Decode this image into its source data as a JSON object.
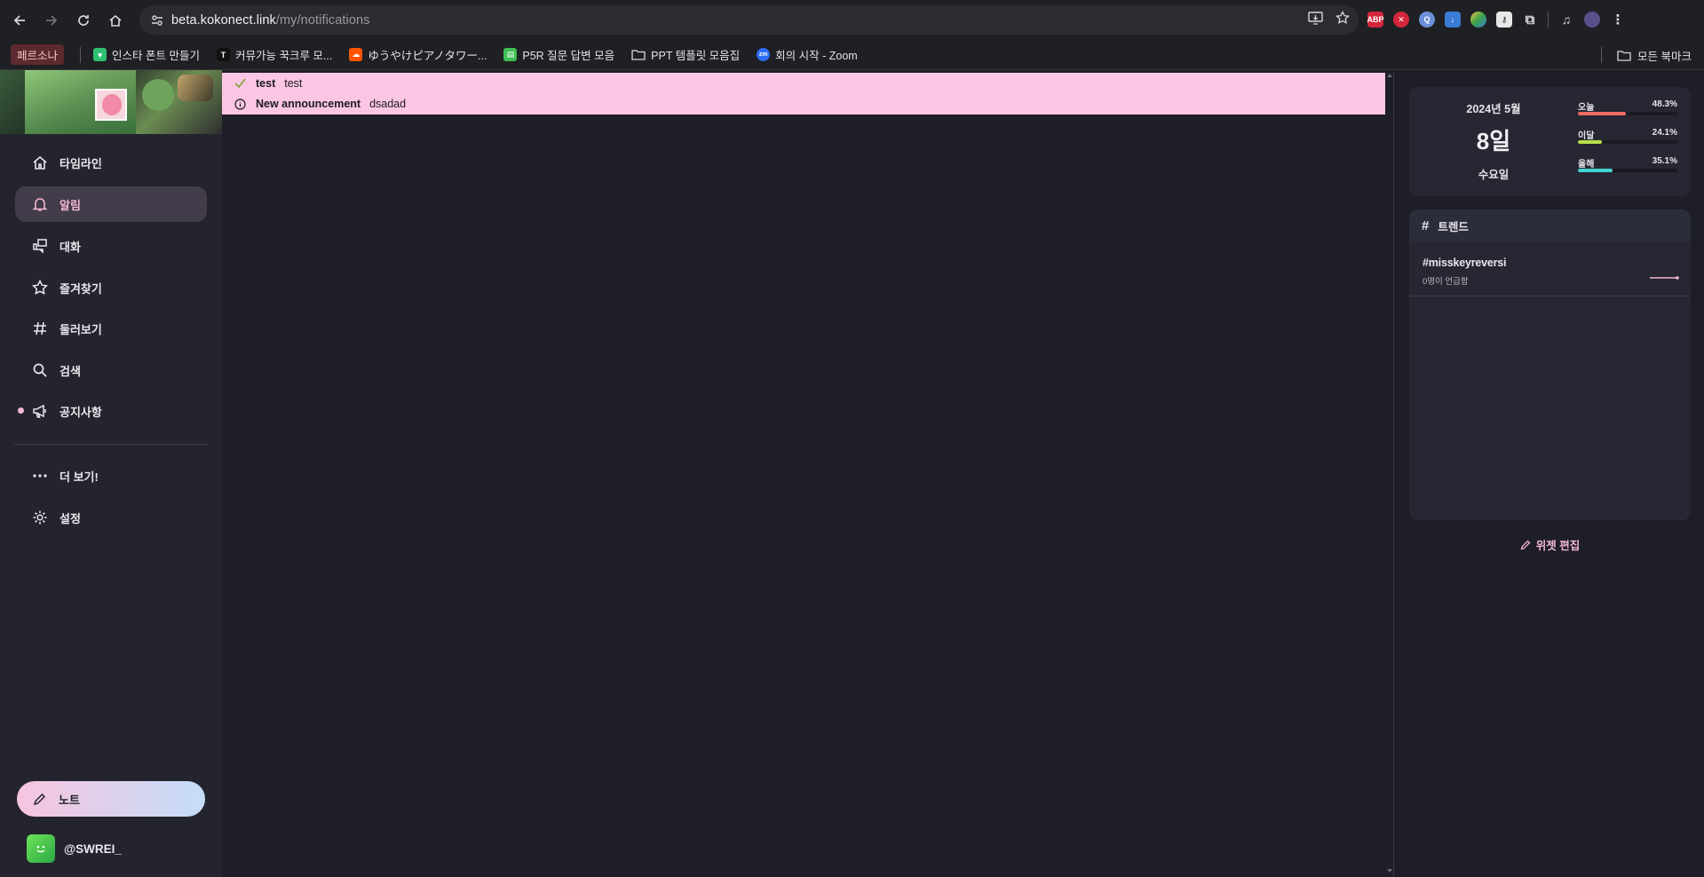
{
  "browser": {
    "url_host": "beta.kokonect.link",
    "url_path": "/my/notifications",
    "bookmarks": [
      {
        "label": "페르소나",
        "type": "tag"
      },
      {
        "label": "인스타 폰트 만들기",
        "color": "#2fbf71"
      },
      {
        "label": "커뮤가능 꾹크루 모...",
        "color": "#111111"
      },
      {
        "label": "ゆうやけピアノタワー...",
        "color": "#ff5500"
      },
      {
        "label": "P5R 질문 답변 모음",
        "color": "#3fbf53"
      },
      {
        "label": "PPT 템플릿 모음집",
        "color": "folder"
      },
      {
        "label": "회의 시작 - Zoom",
        "color": "#2d6cf6"
      }
    ],
    "all_bookmarks_label": "모든 북마크",
    "extensions": [
      {
        "name": "abp",
        "label": "ABP",
        "color": "#d3263c"
      },
      {
        "name": "close",
        "label": "✕",
        "color": "#d3263c"
      },
      {
        "name": "search",
        "label": "Q",
        "color": "#6a90d8"
      },
      {
        "name": "download",
        "label": "↓",
        "color": "#3a7bd5"
      },
      {
        "name": "color",
        "label": "●",
        "color": "#3aa34a"
      },
      {
        "name": "lock",
        "label": "⚷",
        "color": "#e8e8e8"
      },
      {
        "name": "puzzle",
        "label": "✥",
        "color": "#5a5a60"
      }
    ]
  },
  "sidebar": {
    "items": [
      {
        "label": "타임라인",
        "icon": "home-icon"
      },
      {
        "label": "알림",
        "icon": "bell-icon"
      },
      {
        "label": "대화",
        "icon": "chat-icon"
      },
      {
        "label": "즐겨찾기",
        "icon": "star-icon"
      },
      {
        "label": "둘러보기",
        "icon": "hash-icon"
      },
      {
        "label": "검색",
        "icon": "search-icon"
      },
      {
        "label": "공지사항",
        "icon": "megaphone-icon"
      },
      {
        "label": "더 보기!",
        "icon": "dots-icon"
      },
      {
        "label": "설정",
        "icon": "gear-icon"
      }
    ],
    "note_label": "노트",
    "account_name": "@SWREI_"
  },
  "notifications": [
    {
      "title": "test",
      "body": "test",
      "icon": "check-icon"
    },
    {
      "title": "New announcement",
      "body": "dsadad",
      "icon": "info-icon"
    }
  ],
  "calendar": {
    "year_month": "2024년  5월",
    "day": "8일",
    "weekday": "수요일",
    "stats": [
      {
        "label": "오늘",
        "value": "48.3%",
        "fraction": 0.483,
        "color": "#ee6b64"
      },
      {
        "label": "이달",
        "value": "24.1%",
        "fraction": 0.241,
        "color": "#b7e04a"
      },
      {
        "label": "올해",
        "value": "35.1%",
        "fraction": 0.351,
        "color": "#45d4d2"
      }
    ]
  },
  "trends": {
    "title": "트렌드",
    "items": [
      {
        "tag": "#misskeyreversi",
        "sub": "0명이 언급함"
      }
    ]
  },
  "edit_widget_label": "위젯 편집"
}
